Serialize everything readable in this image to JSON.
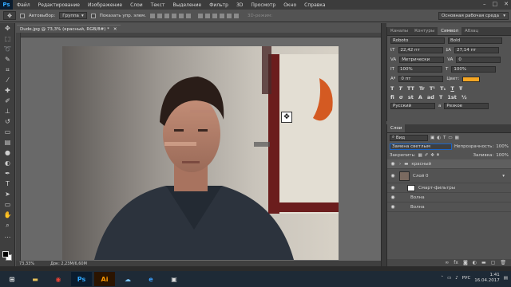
{
  "menu": {
    "items": [
      "Файл",
      "Редактирование",
      "Изображение",
      "Слои",
      "Текст",
      "Выделение",
      "Фильтр",
      "3D",
      "Просмотр",
      "Окно",
      "Справка"
    ]
  },
  "options": {
    "autoselect_label": "Автовыбор:",
    "autoselect_value": "Группа",
    "show_controls_label": "Показать упр. элем.",
    "mode3d_label": "3D-режим:",
    "workspace": "Основная рабочая среда"
  },
  "document": {
    "tab_title": "Dude.jpg @ 73,3% (красный, RGB/8#) *",
    "zoom": "73,33%",
    "doc_size": "Док: 2,23M/6,60M"
  },
  "character_panel": {
    "tabs": [
      "Каналы",
      "Контуры",
      "Символ",
      "Абзац"
    ],
    "active_tab": "Символ",
    "font_family": "Roboto",
    "font_style": "Bold",
    "font_size": "22,42 пт",
    "leading": "27,14 пт",
    "kerning": "Метрически",
    "tracking": "0",
    "vscale": "100%",
    "hscale": "100%",
    "baseline": "0 пт",
    "color_label": "Цвет:",
    "color_value": "#f5a623",
    "formatting": [
      "T",
      "T",
      "TT",
      "Tr",
      "T¹",
      "T₁",
      "T",
      "Ŧ"
    ],
    "opentype": [
      "fi",
      "σ",
      "st",
      "A",
      "ad",
      "T",
      "1st",
      "½"
    ],
    "language": "Русский",
    "aa_prefix": "a",
    "antialias": "Резкое"
  },
  "layers_panel": {
    "title": "Слои",
    "filter_kind": "Вид",
    "blend_mode": "Замена светлым",
    "opacity_label": "Непрозрачность:",
    "opacity_value": "100%",
    "lock_label": "Закрепить:",
    "fill_label": "Заливка:",
    "fill_value": "100%",
    "layers": [
      {
        "name": "красный",
        "type": "group",
        "visible": true
      },
      {
        "name": "Слой 0",
        "type": "smart",
        "visible": true
      },
      {
        "name": "Смарт-фильтры",
        "type": "filters"
      },
      {
        "name": "Волна",
        "type": "filter"
      },
      {
        "name": "Волна",
        "type": "filter"
      }
    ]
  },
  "taskbar": {
    "apps": [
      "start",
      "explorer",
      "chrome",
      "photoshop",
      "illustrator",
      "cloud",
      "edge",
      "film"
    ],
    "ps_label": "Ps",
    "ai_label": "Ai",
    "lang": "РУС",
    "time": "1:41",
    "date": "16.04.2017"
  },
  "colors": {
    "accent": "#f5a623",
    "ps_blue": "#31a8ff"
  }
}
